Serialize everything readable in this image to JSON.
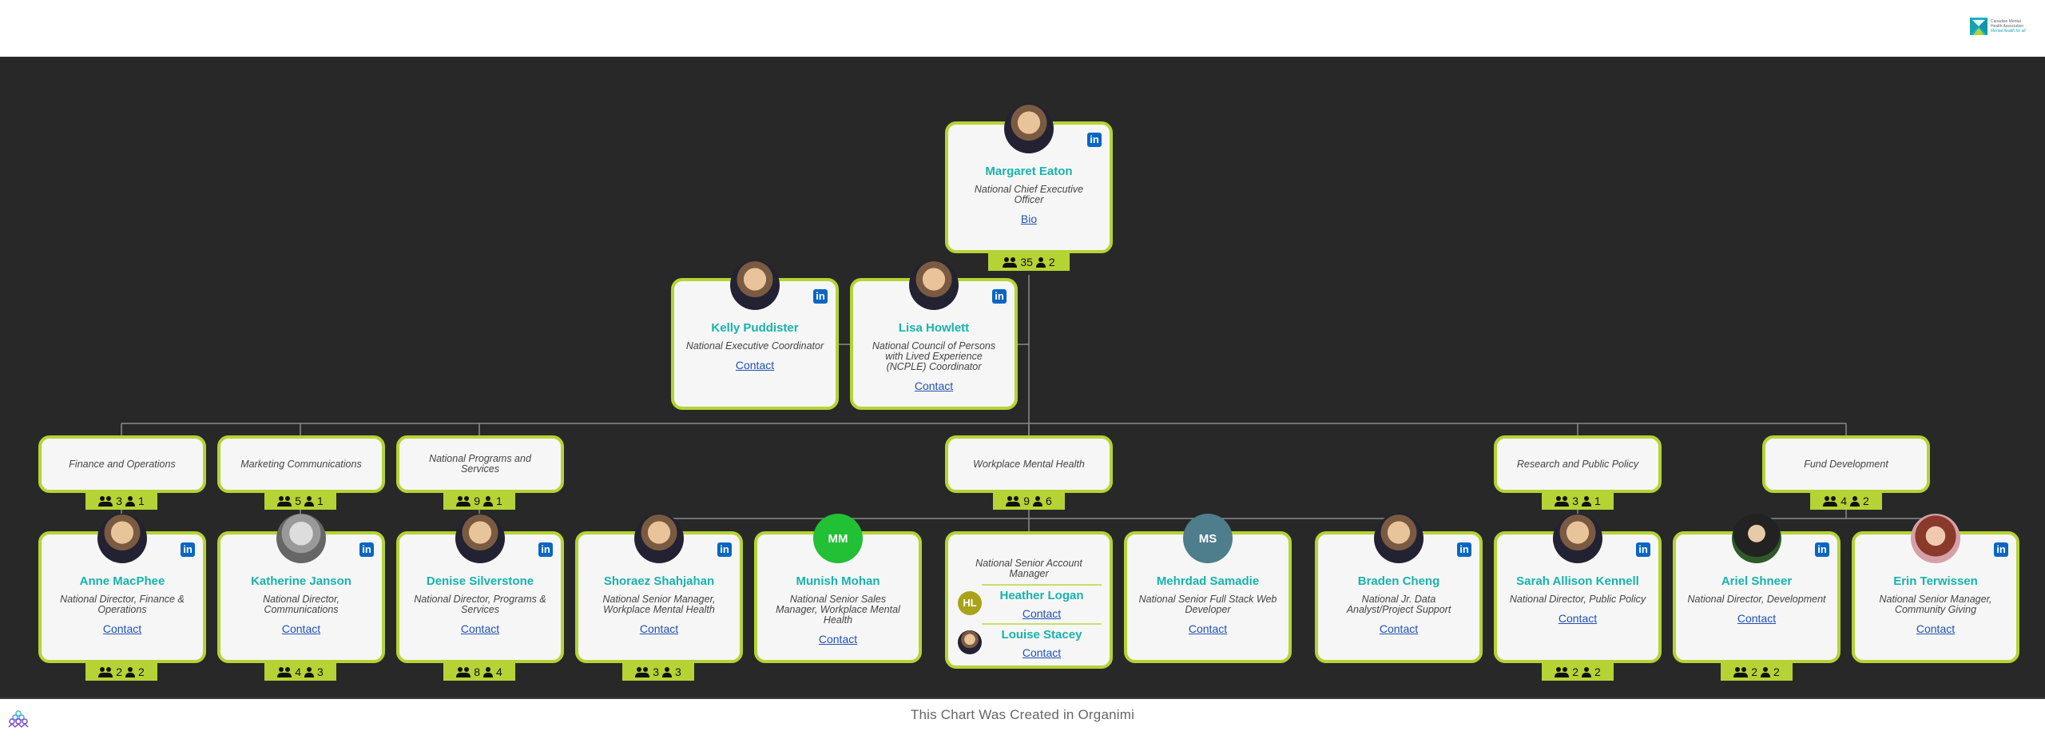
{
  "header": {
    "logo": {
      "line1": "Canadian Mental",
      "line2": "Health Association",
      "tagline": "Mental health for all"
    }
  },
  "footer": {
    "credit": "This Chart Was Created in Organimi"
  },
  "colors": {
    "accent_border": "#b5d334",
    "name_text": "#17b3ad",
    "link": "#2051b5",
    "canvas_bg": "#282828",
    "linkedin": "#0a66c2"
  },
  "ceo": {
    "name": "Margaret Eaton",
    "title": "National Chief Executive Officer",
    "link": "Bio",
    "linkedin": true,
    "badge": {
      "team": "35",
      "direct": "2"
    }
  },
  "assistants": [
    {
      "name": "Kelly Puddister",
      "title": "National Executive Coordinator",
      "link": "Contact",
      "linkedin": true
    },
    {
      "name": "Lisa Howlett",
      "title": "National Council of Persons with Lived Experience (NCPLE) Coordinator",
      "link": "Contact",
      "linkedin": true
    }
  ],
  "departments": [
    {
      "label": "Finance and Operations",
      "badge": {
        "team": "3",
        "direct": "1"
      }
    },
    {
      "label": "Marketing Communications",
      "badge": {
        "team": "5",
        "direct": "1"
      }
    },
    {
      "label": "National Programs and Services",
      "badge": {
        "team": "9",
        "direct": "1"
      }
    },
    {
      "label": "Workplace Mental Health",
      "badge": {
        "team": "9",
        "direct": "6"
      }
    },
    {
      "label": "Research and Public Policy",
      "badge": {
        "team": "3",
        "direct": "1"
      }
    },
    {
      "label": "Fund Development",
      "badge": {
        "team": "4",
        "direct": "2"
      }
    }
  ],
  "people": [
    {
      "name": "Anne MacPhee",
      "title": "National Director, Finance & Operations",
      "link": "Contact",
      "linkedin": true,
      "badge": {
        "team": "2",
        "direct": "2"
      }
    },
    {
      "name": "Katherine Janson",
      "title": "National Director, Communications",
      "link": "Contact",
      "linkedin": true,
      "badge": {
        "team": "4",
        "direct": "3"
      }
    },
    {
      "name": "Denise Silverstone",
      "title": "National Director, Programs & Services",
      "link": "Contact",
      "linkedin": true,
      "badge": {
        "team": "8",
        "direct": "4"
      }
    },
    {
      "name": "Shoraez Shahjahan",
      "title": "National Senior Manager, Workplace Mental Health",
      "link": "Contact",
      "linkedin": true,
      "badge": {
        "team": "3",
        "direct": "3"
      }
    },
    {
      "name": "Munish Mohan",
      "title": "National Senior Sales Manager, Workplace Mental Health",
      "link": "Contact",
      "initials": "MM",
      "avatar_color": "#22c035"
    },
    {
      "name": "Mehrdad Samadie",
      "title": "National Senior Full Stack Web Developer",
      "link": "Contact",
      "initials": "MS",
      "avatar_color": "#4e7d8c"
    },
    {
      "name": "Braden Cheng",
      "title": "National Jr. Data Analyst/Project Support",
      "link": "Contact",
      "linkedin": true
    },
    {
      "name": "Sarah Allison Kennell",
      "title": "National Director, Public Policy",
      "link": "Contact",
      "linkedin": true,
      "badge": {
        "team": "2",
        "direct": "2"
      }
    },
    {
      "name": "Ariel Shneer",
      "title": "National Director, Development",
      "link": "Contact",
      "linkedin": true,
      "badge": {
        "team": "2",
        "direct": "2"
      }
    },
    {
      "name": "Erin Terwissen",
      "title": "National Senior Manager, Community Giving",
      "link": "Contact",
      "linkedin": true
    }
  ],
  "shared_role": {
    "title": "National Senior Account Manager",
    "members": [
      {
        "name": "Heather Logan",
        "link": "Contact",
        "initials": "HL",
        "avatar_color": "#a9a31c"
      },
      {
        "name": "Louise Stacey",
        "link": "Contact"
      }
    ]
  }
}
